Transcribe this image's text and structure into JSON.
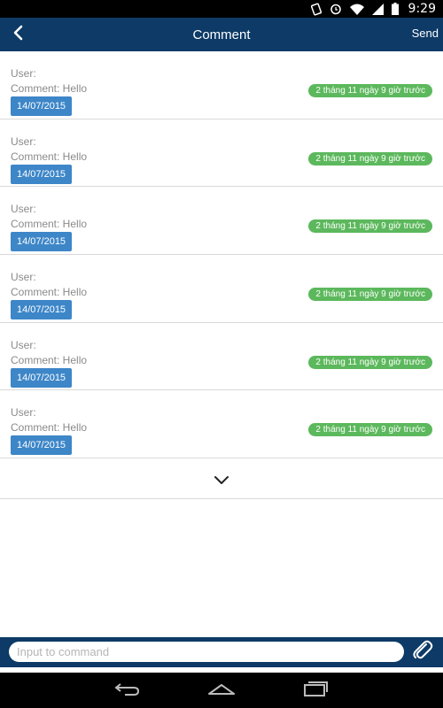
{
  "status_bar": {
    "time": "9:29"
  },
  "header": {
    "title": "Comment",
    "send_label": "Send"
  },
  "comments": [
    {
      "user": "User:",
      "comment": "Comment: Hello",
      "date": "14/07/2015",
      "ago": "2 tháng 11 ngày 9 giờ trước"
    },
    {
      "user": "User:",
      "comment": "Comment: Hello",
      "date": "14/07/2015",
      "ago": "2 tháng 11 ngày 9 giờ trước"
    },
    {
      "user": "User:",
      "comment": "Comment: Hello",
      "date": "14/07/2015",
      "ago": "2 tháng 11 ngày 9 giờ trước"
    },
    {
      "user": "User:",
      "comment": "Comment: Hello",
      "date": "14/07/2015",
      "ago": "2 tháng 11 ngày 9 giờ trước"
    },
    {
      "user": "User:",
      "comment": "Comment: Hello",
      "date": "14/07/2015",
      "ago": "2 tháng 11 ngày 9 giờ trước"
    },
    {
      "user": "User:",
      "comment": "Comment: Hello",
      "date": "14/07/2015",
      "ago": "2 tháng 11 ngày 9 giờ trước"
    }
  ],
  "input": {
    "placeholder": "Input to command",
    "value": ""
  },
  "colors": {
    "header": "#0d3a66",
    "date_badge": "#3d86c8",
    "ago_badge": "#5cb85c"
  },
  "icons": {
    "status": [
      "vibrate-icon",
      "alarm-icon",
      "wifi-icon",
      "signal-icon",
      "battery-icon"
    ],
    "header": [
      "back-icon"
    ],
    "list": [
      "chevron-down-icon"
    ],
    "input": [
      "paperclip-icon"
    ],
    "nav": [
      "nav-back-icon",
      "nav-home-icon",
      "nav-recents-icon"
    ]
  }
}
